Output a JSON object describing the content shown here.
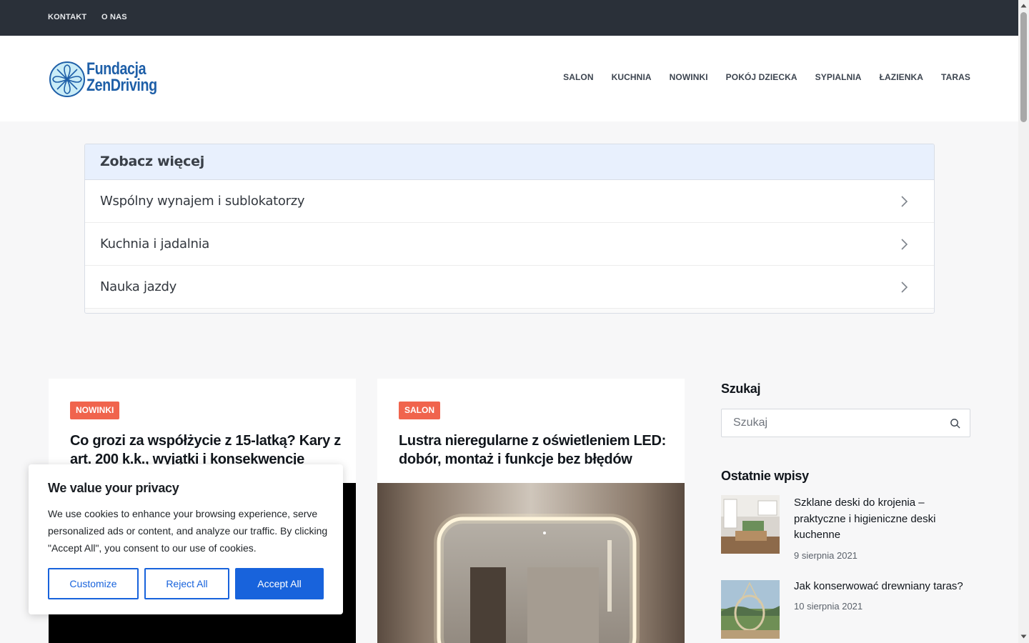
{
  "topbar": {
    "links": [
      "KONTAKT",
      "O NAS"
    ]
  },
  "header": {
    "logo_line1": "Fundacja",
    "logo_line2": "ZenDriving",
    "nav": [
      "SALON",
      "KUCHNIA",
      "NOWINKI",
      "POKÓJ DZIECKA",
      "SYPIALNIA",
      "ŁAZIENKA",
      "TARAS"
    ]
  },
  "see_more": {
    "title": "Zobacz więcej",
    "items": [
      "Wspólny wynajem i sublokatorzy",
      "Kuchnia i jadalnia",
      "Nauka jazdy"
    ]
  },
  "cards": [
    {
      "badge": "NOWINKI",
      "title": "Co grozi za współżycie z 15-latką? Kary z art. 200 k.k., wyjątki i konsekwencje"
    },
    {
      "badge": "SALON",
      "title": "Lustra nieregularne z oświetleniem LED: dobór, montaż i funkcje bez błędów"
    }
  ],
  "sidebar": {
    "search_title": "Szukaj",
    "search_placeholder": "Szukaj",
    "recent_title": "Ostatnie wpisy",
    "posts": [
      {
        "title": "Szklane deski do krojenia – praktyczne i higieniczne deski kuchenne",
        "date": "9 sierpnia 2021"
      },
      {
        "title": "Jak konserwować drewniany taras?",
        "date": "10 sierpnia 2021"
      }
    ]
  },
  "cookie": {
    "title": "We value your privacy",
    "text": "We use cookies to enhance your browsing experience, serve personalized ads or content, and analyze our traffic. By clicking \"Accept All\", you consent to our use of cookies.",
    "customize": "Customize",
    "reject": "Reject All",
    "accept": "Accept All"
  },
  "colors": {
    "topbar": "#2a3039",
    "badge": "#f0644d",
    "accent": "#1863dc",
    "logo": "#1e5fa8"
  }
}
